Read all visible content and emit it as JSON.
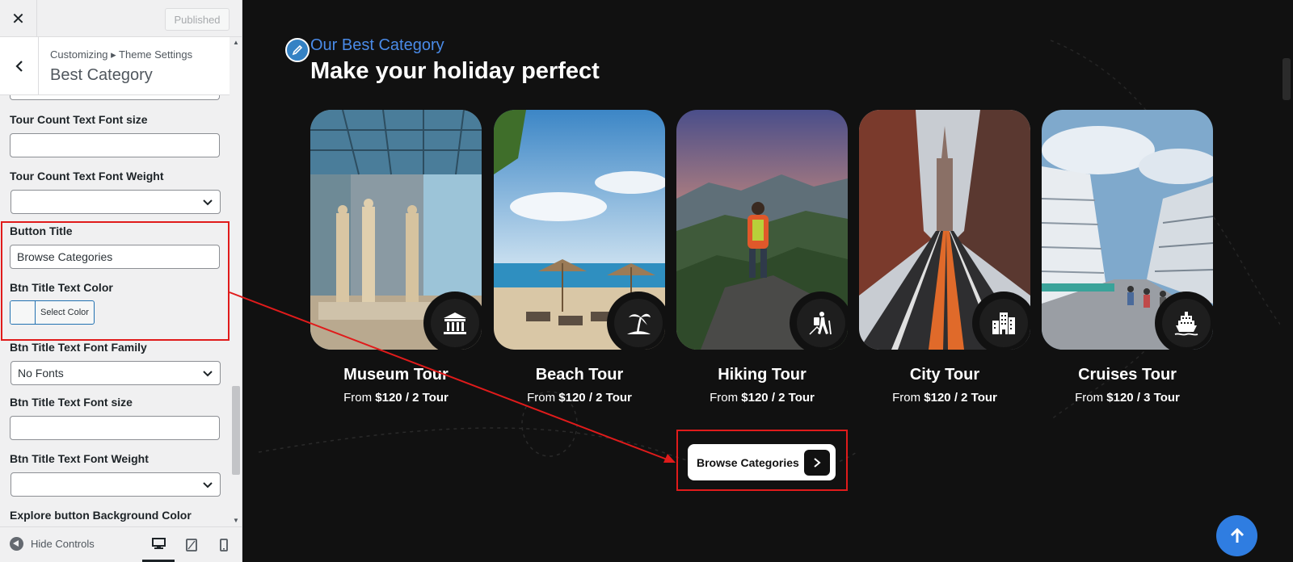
{
  "sidebar": {
    "close_icon": "close-icon",
    "publish_label": "Published",
    "breadcrumb": "Customizing ▸ Theme Settings",
    "section_title": "Best Category",
    "fields": {
      "tour_count_font_size": {
        "label": "Tour Count Text Font size",
        "value": ""
      },
      "tour_count_font_weight": {
        "label": "Tour Count Text Font Weight",
        "value": ""
      },
      "button_title": {
        "label": "Button Title",
        "value": "Browse Categories"
      },
      "btn_title_text_color": {
        "label": "Btn Title Text Color",
        "button": "Select Color"
      },
      "btn_title_font_family": {
        "label": "Btn Title Text Font Family",
        "value": "No Fonts"
      },
      "btn_title_font_size": {
        "label": "Btn Title Text Font size",
        "value": ""
      },
      "btn_title_font_weight": {
        "label": "Btn Title Text Font Weight",
        "value": ""
      },
      "explore_bg_color": {
        "label": "Explore button Background Color"
      }
    },
    "footer": {
      "hide_controls": "Hide Controls",
      "devices": [
        "desktop",
        "tablet",
        "mobile"
      ],
      "active_device": "desktop"
    }
  },
  "preview": {
    "subtitle": "Our Best Category",
    "heading": "Make your holiday perfect",
    "cards": [
      {
        "title": "Museum Tour",
        "price_prefix": "From ",
        "price": "$120",
        "tours": " / 2 Tour",
        "icon": "museum-icon"
      },
      {
        "title": "Beach Tour",
        "price_prefix": "From ",
        "price": "$120",
        "tours": " / 2 Tour",
        "icon": "palm-tree-icon"
      },
      {
        "title": "Hiking Tour",
        "price_prefix": "From ",
        "price": "$120",
        "tours": " / 2 Tour",
        "icon": "hiker-icon"
      },
      {
        "title": "City Tour",
        "price_prefix": "From ",
        "price": "$120",
        "tours": " / 2 Tour",
        "icon": "city-buildings-icon"
      },
      {
        "title": "Cruises Tour",
        "price_prefix": "From ",
        "price": "$120",
        "tours": " / 3 Tour",
        "icon": "ship-icon"
      }
    ],
    "browse_button": "Browse Categories",
    "colors": {
      "background": "#111111",
      "accent_blue": "#4a8be8",
      "scroll_top_button": "#2f7de1",
      "annotation_red": "#e01b1b"
    }
  }
}
